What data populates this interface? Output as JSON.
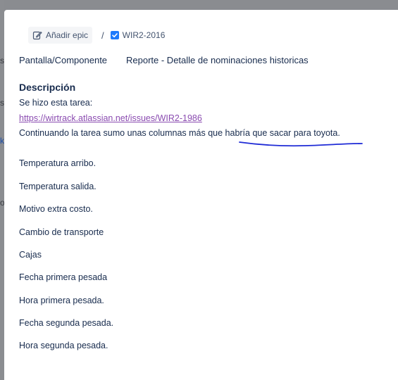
{
  "backdrop": {
    "glyphs": [
      "s",
      "s",
      "k",
      "os"
    ]
  },
  "header": {
    "epic_button_label": "Añadir epic",
    "separator": "/",
    "issue_key": "WIR2-2016"
  },
  "field": {
    "label": "Pantalla/Componente",
    "value": "Reporte - Detalle de nominaciones historicas"
  },
  "description": {
    "heading": "Descripción",
    "intro": "Se hizo esta tarea:",
    "link": "https://wirtrack.atlassian.net/issues/WIR2-1986",
    "note": "Continuando la tarea sumo unas columnas más que habría que sacar para toyota.",
    "items": [
      "Temperatura arribo.",
      "Temperatura salida.",
      "Motivo extra costo.",
      "Cambio de transporte",
      "Cajas",
      "Fecha primera pesada",
      "Hora primera pesada.",
      "Fecha segunda pesada.",
      "Hora segunda pesada."
    ]
  },
  "colors": {
    "annotation_stroke": "#1f2bd6",
    "link": "#8a4bb0",
    "check_accent": "#1d7afc"
  }
}
